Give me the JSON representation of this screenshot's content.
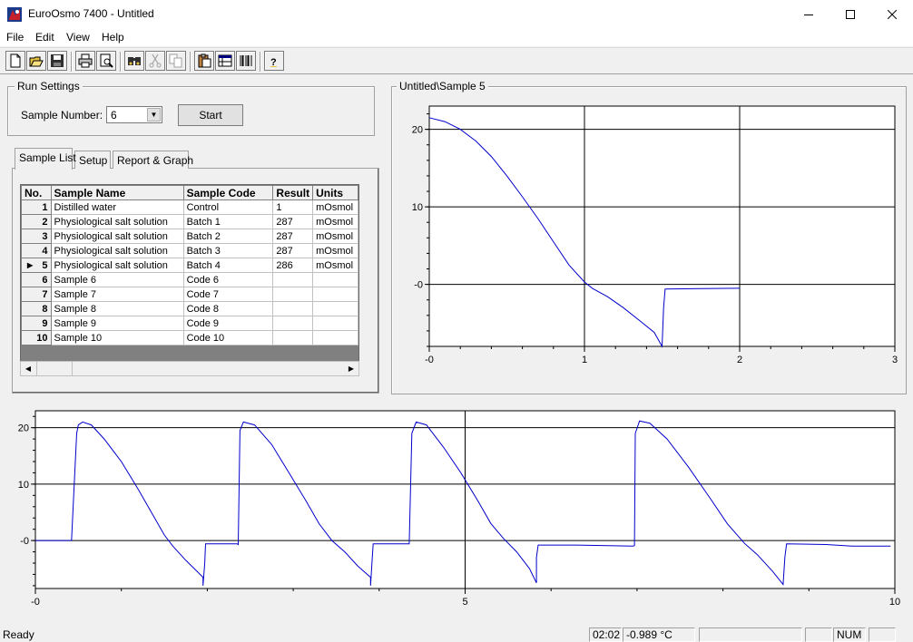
{
  "window": {
    "title": "EuroOsmo 7400 - Untitled",
    "minimize": "—",
    "maximize": "☐",
    "close": "✕"
  },
  "menu": [
    "File",
    "Edit",
    "View",
    "Help"
  ],
  "toolbar": {
    "buttons": [
      "new-file-icon",
      "open-folder-icon",
      "save-icon",
      "print-icon",
      "print-preview-icon",
      "binoculars-icon",
      "cut-icon",
      "copy-icon",
      "clipboard-icon",
      "table-view-icon",
      "barcode-icon",
      "help-icon"
    ]
  },
  "run_settings": {
    "title": "Run Settings",
    "sample_number_label": "Sample Number:",
    "sample_number_value": "6",
    "start_label": "Start"
  },
  "tabs": [
    "Sample List",
    "Setup",
    "Report & Graph"
  ],
  "grid": {
    "columns": [
      "No.",
      "Sample Name",
      "Sample Code",
      "Result",
      "Units"
    ],
    "rows": [
      [
        "1",
        "Distilled water",
        "Control",
        "1",
        "mOsmol"
      ],
      [
        "2",
        "Physiological salt solution",
        "Batch 1",
        "287",
        "mOsmol"
      ],
      [
        "3",
        "Physiological salt solution",
        "Batch 2",
        "287",
        "mOsmol"
      ],
      [
        "4",
        "Physiological salt solution",
        "Batch 3",
        "287",
        "mOsmol"
      ],
      [
        "5",
        "Physiological salt solution",
        "Batch 4",
        "286",
        "mOsmol"
      ],
      [
        "6",
        "Sample 6",
        "Code 6",
        "",
        ""
      ],
      [
        "7",
        "Sample 7",
        "Code 7",
        "",
        ""
      ],
      [
        "8",
        "Sample 8",
        "Code 8",
        "",
        ""
      ],
      [
        "9",
        "Sample 9",
        "Code 9",
        "",
        ""
      ],
      [
        "10",
        "Sample 10",
        "Code 10",
        "",
        ""
      ]
    ],
    "current_row": 5
  },
  "chart_data": [
    {
      "type": "line",
      "title": "Untitled\\Sample 5",
      "xlim": [
        0,
        3
      ],
      "ylim": [
        -8,
        23
      ],
      "xticks": [
        "-0",
        "1",
        "2",
        "3"
      ],
      "yticks": [
        "20",
        "10",
        "-0"
      ],
      "series": [
        {
          "color": "#0000cc",
          "points": [
            [
              0,
              21.5
            ],
            [
              0.1,
              21
            ],
            [
              0.2,
              20
            ],
            [
              0.3,
              18.5
            ],
            [
              0.4,
              16.5
            ],
            [
              0.5,
              14
            ],
            [
              0.6,
              11.3
            ],
            [
              0.7,
              8.5
            ],
            [
              0.8,
              5.5
            ],
            [
              0.9,
              2.5
            ],
            [
              1.0,
              0.3
            ],
            [
              1.05,
              -0.5
            ],
            [
              1.15,
              -1.6
            ],
            [
              1.25,
              -3
            ],
            [
              1.35,
              -4.6
            ],
            [
              1.45,
              -6.2
            ],
            [
              1.5,
              -8
            ],
            [
              1.51,
              -3
            ],
            [
              1.52,
              -0.6
            ],
            [
              2.0,
              -0.5
            ]
          ]
        }
      ]
    },
    {
      "type": "line",
      "xlim": [
        0,
        10
      ],
      "ylim": [
        -8.5,
        23
      ],
      "xticks": [
        "-0",
        "5",
        "10"
      ],
      "yticks": [
        "20",
        "10",
        "-0"
      ],
      "series": [
        {
          "color": "#0000cc",
          "points": [
            [
              0,
              0
            ],
            [
              0.42,
              0
            ],
            [
              0.48,
              19
            ],
            [
              0.5,
              20.5
            ],
            [
              0.55,
              21
            ],
            [
              0.65,
              20.5
            ],
            [
              0.8,
              18
            ],
            [
              1.0,
              14
            ],
            [
              1.2,
              9
            ],
            [
              1.35,
              5
            ],
            [
              1.5,
              1
            ],
            [
              1.6,
              -1
            ],
            [
              1.75,
              -3.5
            ],
            [
              1.95,
              -6.5
            ],
            [
              1.95,
              -8
            ],
            [
              1.97,
              -4
            ],
            [
              1.98,
              -0.6
            ],
            [
              2.35,
              -0.6
            ],
            [
              2.36,
              -0.7
            ],
            [
              2.38,
              19.5
            ],
            [
              2.42,
              21
            ],
            [
              2.55,
              20.5
            ],
            [
              2.75,
              17
            ],
            [
              2.95,
              12
            ],
            [
              3.15,
              7
            ],
            [
              3.3,
              3
            ],
            [
              3.45,
              0
            ],
            [
              3.6,
              -2
            ],
            [
              3.75,
              -4.5
            ],
            [
              3.9,
              -6.5
            ],
            [
              3.9,
              -8
            ],
            [
              3.92,
              -3
            ],
            [
              3.93,
              -0.6
            ],
            [
              4.35,
              -0.6
            ],
            [
              4.38,
              19
            ],
            [
              4.43,
              21
            ],
            [
              4.55,
              20.5
            ],
            [
              4.75,
              16.5
            ],
            [
              4.95,
              12
            ],
            [
              5.15,
              7
            ],
            [
              5.3,
              3
            ],
            [
              5.45,
              0.3
            ],
            [
              5.6,
              -2
            ],
            [
              5.75,
              -5
            ],
            [
              5.83,
              -7.5
            ],
            [
              5.83,
              -3
            ],
            [
              5.85,
              -0.8
            ],
            [
              6.3,
              -0.8
            ],
            [
              6.95,
              -1
            ],
            [
              6.97,
              -0.9
            ],
            [
              6.98,
              19
            ],
            [
              7.03,
              21.2
            ],
            [
              7.15,
              20.8
            ],
            [
              7.35,
              18
            ],
            [
              7.6,
              13
            ],
            [
              7.85,
              7.5
            ],
            [
              8.05,
              3
            ],
            [
              8.25,
              -0.5
            ],
            [
              8.4,
              -2.5
            ],
            [
              8.58,
              -5.5
            ],
            [
              8.7,
              -7.8
            ],
            [
              8.72,
              -3
            ],
            [
              8.74,
              -0.6
            ],
            [
              9.2,
              -0.7
            ],
            [
              9.5,
              -1
            ],
            [
              9.95,
              -1
            ]
          ]
        }
      ]
    }
  ],
  "status": {
    "ready": "Ready",
    "time": "02:02",
    "temperature": "-0.989 °C",
    "num": "NUM"
  }
}
